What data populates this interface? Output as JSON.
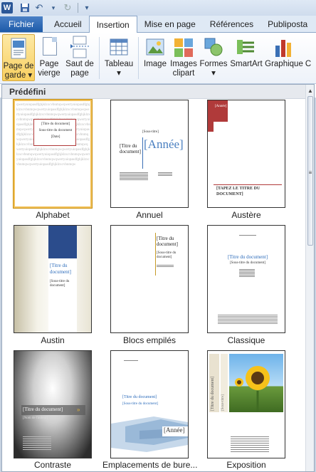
{
  "qat": {
    "logo": "W",
    "undo": "↶",
    "redo": "↻",
    "customize": "▾"
  },
  "tabs": [
    "Fichier",
    "Accueil",
    "Insertion",
    "Mise en page",
    "Références",
    "Publiposta"
  ],
  "ribbon": {
    "cover_page": [
      "Page de",
      "garde ▾"
    ],
    "blank_page": [
      "Page",
      "vierge"
    ],
    "page_break": [
      "Saut de",
      "page"
    ],
    "table": [
      "Tableau",
      "▾"
    ],
    "image": "Image",
    "clipart": [
      "Images",
      "clipart"
    ],
    "shapes": [
      "Formes",
      "▾"
    ],
    "smartart": "SmartArt",
    "chart": "Graphique",
    "more": "C"
  },
  "gallery": {
    "header": "Prédéfini",
    "items": [
      {
        "caption": "Alphabet"
      },
      {
        "caption": "Annuel"
      },
      {
        "caption": "Austère"
      },
      {
        "caption": "Austin"
      },
      {
        "caption": "Blocs empilés"
      },
      {
        "caption": "Classique"
      },
      {
        "caption": "Contraste"
      },
      {
        "caption": "Emplacements de bure..."
      },
      {
        "caption": "Exposition"
      }
    ],
    "previews": {
      "alphabet": {
        "bg_text": "qwertyuiopasdfghjklzxcvbnmqw",
        "title": "[Titre du document]",
        "sub": "Sous-titre du document",
        "date": "[Date]"
      },
      "annuel": {
        "title": "[Titre du document]",
        "sub": "[Sous-titre]",
        "year": "[Année]"
      },
      "austere": {
        "year": "[Année]",
        "title": "[TAPEZ LE TITRE DU DOCUMENT]"
      },
      "austin": {
        "title": "[Titre du document]",
        "sub": "[Sous-titre du document]"
      },
      "blocs": {
        "title": "[Titre du document]",
        "sub": "[Sous-titre du document]"
      },
      "classique": {
        "title": "[Titre du document]",
        "sub": "[Sous-titre du document]"
      },
      "contraste": {
        "title": "[Titre du document]",
        "sub": "[Nom de l'auteur]"
      },
      "emplacements": {
        "title": "[Titre du document]",
        "sub": "[Sous-titre du document]",
        "year": "[Année]"
      },
      "exposition": {
        "title": "[Titre du document]",
        "sub": "[Sous-titre]"
      }
    }
  },
  "colors": {
    "accent": "#2e6dbb",
    "selected": "#f8cf5f",
    "austin_top": "#2b4c8c",
    "austere_red": "#c0392b"
  }
}
